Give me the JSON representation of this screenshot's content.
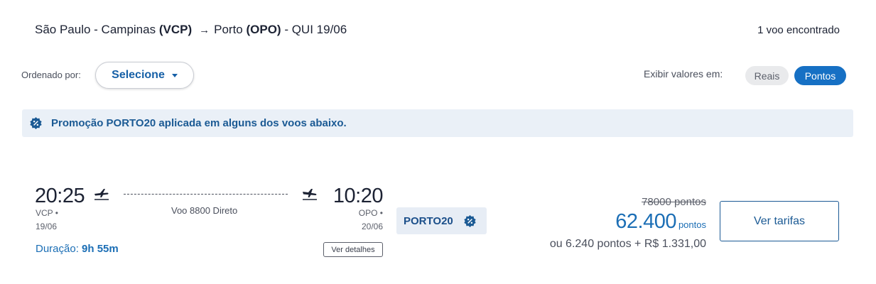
{
  "header": {
    "origin_city": "São Paulo - Campinas",
    "origin_code": "(VCP)",
    "arrow": "→",
    "dest_city": "Porto",
    "dest_code": "(OPO)",
    "date_suffix": "- QUI 19/06",
    "result_count": "1 voo encontrado"
  },
  "sort": {
    "label": "Ordenado por:",
    "selected": "Selecione"
  },
  "display_values": {
    "label": "Exibir valores em:",
    "options": [
      "Reais",
      "Pontos"
    ],
    "active": "Pontos"
  },
  "promo_banner": {
    "icon": "discount-badge-icon",
    "text": "Promoção PORTO20 aplicada em alguns dos voos abaixo."
  },
  "flight": {
    "departure_time": "20:25",
    "departure_code": "VCP •",
    "departure_date": "19/06",
    "arrival_time": "10:20",
    "arrival_code": "OPO •",
    "arrival_date": "20/06",
    "flight_info": "Voo 8800 Direto",
    "duration_label": "Duração:",
    "duration_value": "9h 55m",
    "details_button": "Ver detalhes",
    "promo_code": "PORTO20",
    "original_price": "78000 pontos",
    "price_points": "62.400",
    "price_unit": "pontos",
    "alt_price": "ou 6.240 pontos + R$ 1.331,00",
    "fares_button": "Ver tarifas"
  },
  "colors": {
    "accent": "#1670c4",
    "link": "#1b6eb5",
    "banner_bg": "#eaf0f7",
    "badge": "#1b5a94"
  }
}
